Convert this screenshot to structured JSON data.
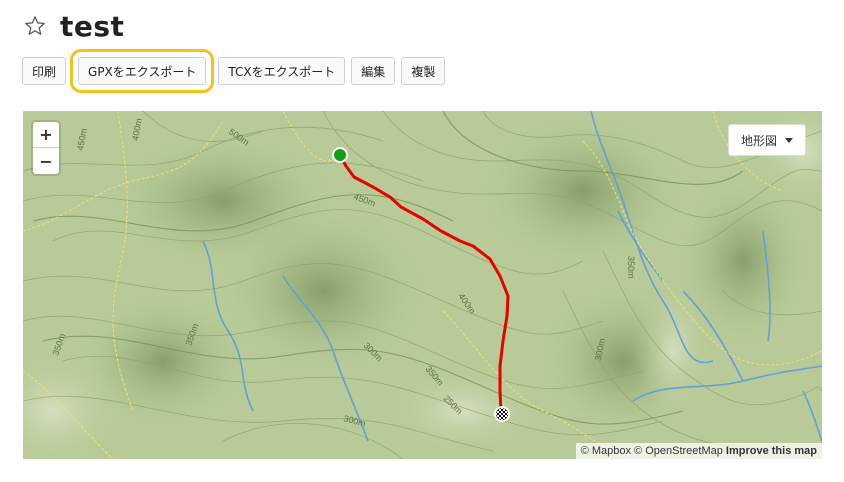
{
  "header": {
    "title": "test",
    "favorite_icon": "star-outline-icon"
  },
  "toolbar": {
    "print_label": "印刷",
    "gpx_label": "GPXをエクスポート",
    "tcx_label": "TCXをエクスポート",
    "edit_label": "編集",
    "duplicate_label": "複製"
  },
  "map": {
    "zoom_in_label": "+",
    "zoom_out_label": "−",
    "layer_label": "地形図",
    "attribution": {
      "mapbox": "© Mapbox",
      "osm": "© OpenStreetMap",
      "improve": "Improve this map"
    },
    "contour_labels": [
      "500m",
      "450m",
      "400m",
      "450m",
      "400m",
      "350m",
      "300m",
      "350m",
      "350m",
      "250m",
      "300m",
      "300m",
      "350m"
    ],
    "route_color": "#e60000",
    "start_color": "#10a010",
    "highlight_color": "#f6c21a"
  }
}
